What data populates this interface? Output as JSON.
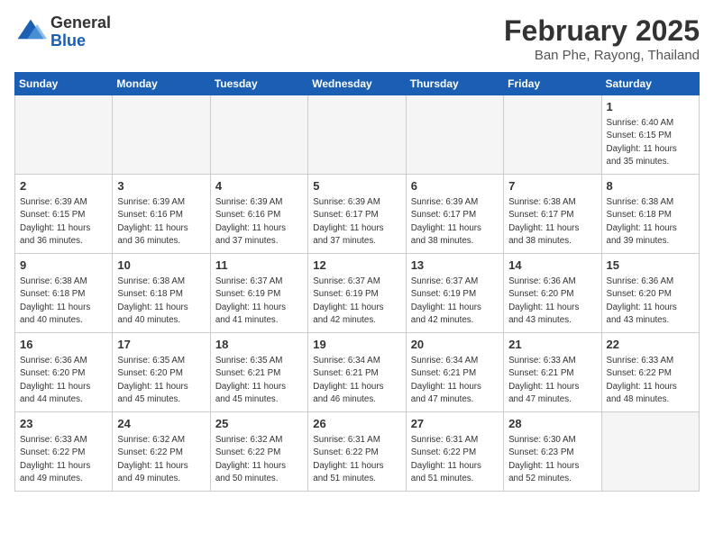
{
  "header": {
    "logo_general": "General",
    "logo_blue": "Blue",
    "month_title": "February 2025",
    "location": "Ban Phe, Rayong, Thailand"
  },
  "weekdays": [
    "Sunday",
    "Monday",
    "Tuesday",
    "Wednesday",
    "Thursday",
    "Friday",
    "Saturday"
  ],
  "weeks": [
    [
      {
        "day": "",
        "info": ""
      },
      {
        "day": "",
        "info": ""
      },
      {
        "day": "",
        "info": ""
      },
      {
        "day": "",
        "info": ""
      },
      {
        "day": "",
        "info": ""
      },
      {
        "day": "",
        "info": ""
      },
      {
        "day": "1",
        "info": "Sunrise: 6:40 AM\nSunset: 6:15 PM\nDaylight: 11 hours\nand 35 minutes."
      }
    ],
    [
      {
        "day": "2",
        "info": "Sunrise: 6:39 AM\nSunset: 6:15 PM\nDaylight: 11 hours\nand 36 minutes."
      },
      {
        "day": "3",
        "info": "Sunrise: 6:39 AM\nSunset: 6:16 PM\nDaylight: 11 hours\nand 36 minutes."
      },
      {
        "day": "4",
        "info": "Sunrise: 6:39 AM\nSunset: 6:16 PM\nDaylight: 11 hours\nand 37 minutes."
      },
      {
        "day": "5",
        "info": "Sunrise: 6:39 AM\nSunset: 6:17 PM\nDaylight: 11 hours\nand 37 minutes."
      },
      {
        "day": "6",
        "info": "Sunrise: 6:39 AM\nSunset: 6:17 PM\nDaylight: 11 hours\nand 38 minutes."
      },
      {
        "day": "7",
        "info": "Sunrise: 6:38 AM\nSunset: 6:17 PM\nDaylight: 11 hours\nand 38 minutes."
      },
      {
        "day": "8",
        "info": "Sunrise: 6:38 AM\nSunset: 6:18 PM\nDaylight: 11 hours\nand 39 minutes."
      }
    ],
    [
      {
        "day": "9",
        "info": "Sunrise: 6:38 AM\nSunset: 6:18 PM\nDaylight: 11 hours\nand 40 minutes."
      },
      {
        "day": "10",
        "info": "Sunrise: 6:38 AM\nSunset: 6:18 PM\nDaylight: 11 hours\nand 40 minutes."
      },
      {
        "day": "11",
        "info": "Sunrise: 6:37 AM\nSunset: 6:19 PM\nDaylight: 11 hours\nand 41 minutes."
      },
      {
        "day": "12",
        "info": "Sunrise: 6:37 AM\nSunset: 6:19 PM\nDaylight: 11 hours\nand 42 minutes."
      },
      {
        "day": "13",
        "info": "Sunrise: 6:37 AM\nSunset: 6:19 PM\nDaylight: 11 hours\nand 42 minutes."
      },
      {
        "day": "14",
        "info": "Sunrise: 6:36 AM\nSunset: 6:20 PM\nDaylight: 11 hours\nand 43 minutes."
      },
      {
        "day": "15",
        "info": "Sunrise: 6:36 AM\nSunset: 6:20 PM\nDaylight: 11 hours\nand 43 minutes."
      }
    ],
    [
      {
        "day": "16",
        "info": "Sunrise: 6:36 AM\nSunset: 6:20 PM\nDaylight: 11 hours\nand 44 minutes."
      },
      {
        "day": "17",
        "info": "Sunrise: 6:35 AM\nSunset: 6:20 PM\nDaylight: 11 hours\nand 45 minutes."
      },
      {
        "day": "18",
        "info": "Sunrise: 6:35 AM\nSunset: 6:21 PM\nDaylight: 11 hours\nand 45 minutes."
      },
      {
        "day": "19",
        "info": "Sunrise: 6:34 AM\nSunset: 6:21 PM\nDaylight: 11 hours\nand 46 minutes."
      },
      {
        "day": "20",
        "info": "Sunrise: 6:34 AM\nSunset: 6:21 PM\nDaylight: 11 hours\nand 47 minutes."
      },
      {
        "day": "21",
        "info": "Sunrise: 6:33 AM\nSunset: 6:21 PM\nDaylight: 11 hours\nand 47 minutes."
      },
      {
        "day": "22",
        "info": "Sunrise: 6:33 AM\nSunset: 6:22 PM\nDaylight: 11 hours\nand 48 minutes."
      }
    ],
    [
      {
        "day": "23",
        "info": "Sunrise: 6:33 AM\nSunset: 6:22 PM\nDaylight: 11 hours\nand 49 minutes."
      },
      {
        "day": "24",
        "info": "Sunrise: 6:32 AM\nSunset: 6:22 PM\nDaylight: 11 hours\nand 49 minutes."
      },
      {
        "day": "25",
        "info": "Sunrise: 6:32 AM\nSunset: 6:22 PM\nDaylight: 11 hours\nand 50 minutes."
      },
      {
        "day": "26",
        "info": "Sunrise: 6:31 AM\nSunset: 6:22 PM\nDaylight: 11 hours\nand 51 minutes."
      },
      {
        "day": "27",
        "info": "Sunrise: 6:31 AM\nSunset: 6:22 PM\nDaylight: 11 hours\nand 51 minutes."
      },
      {
        "day": "28",
        "info": "Sunrise: 6:30 AM\nSunset: 6:23 PM\nDaylight: 11 hours\nand 52 minutes."
      },
      {
        "day": "",
        "info": ""
      }
    ]
  ]
}
